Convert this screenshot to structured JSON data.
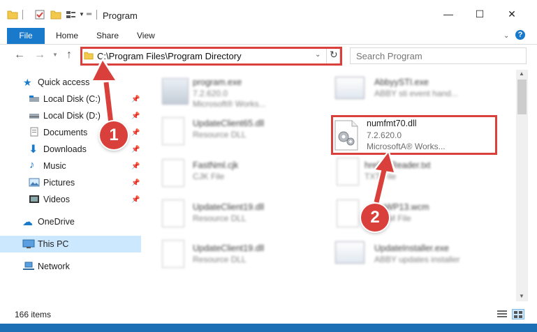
{
  "window": {
    "title": "Program",
    "controls": {
      "minimize": "—",
      "maximize": "☐",
      "close": "✕"
    }
  },
  "ribbon": {
    "tabs": [
      {
        "label": "File"
      },
      {
        "label": "Home"
      },
      {
        "label": "Share"
      },
      {
        "label": "View"
      }
    ],
    "help": "?"
  },
  "navigation": {
    "address_path": "C:\\Program Files\\Program Directory",
    "search_placeholder": "Search Program"
  },
  "sidebar": {
    "quick_access": "Quick access",
    "items": [
      {
        "label": "Local Disk (C:)",
        "icon": "drive-icon"
      },
      {
        "label": "Local Disk (D:)",
        "icon": "drive-icon"
      },
      {
        "label": "Documents",
        "icon": "documents-icon"
      },
      {
        "label": "Downloads",
        "icon": "downloads-icon"
      },
      {
        "label": "Music",
        "icon": "music-icon"
      },
      {
        "label": "Pictures",
        "icon": "pictures-icon"
      },
      {
        "label": "Videos",
        "icon": "videos-icon"
      }
    ],
    "onedrive": "OneDrive",
    "this_pc": "This PC",
    "network": "Network"
  },
  "files": {
    "col1": [
      {
        "name": "program.exe",
        "line2": "7.2.620.0",
        "line3": "Microsoft® Works..."
      },
      {
        "name": "UpdateClient65.dll",
        "line2": "Resource DLL"
      },
      {
        "name": "FastNml.cjk",
        "line2": "CJK File"
      },
      {
        "name": "UpdateClient19.dll",
        "line2": "Resource DLL"
      },
      {
        "name": "UpdateClient19.dll",
        "line2": "Resource DLL"
      }
    ],
    "col2": [
      {
        "name": "AbbyySTI.exe",
        "line2": "ABBY sti event hand..."
      },
      {
        "name": "numfmt70.dll",
        "line2": "7.2.620.0",
        "line3": "MicrosoftA® Works..."
      },
      {
        "name": "hrelineReader.txt",
        "line2": "TXT File"
      },
      {
        "name": "SoWP13.wcm",
        "line2": "WCM File"
      },
      {
        "name": "UpdateInstaller.exe",
        "line2": "ABBY updates installer"
      }
    ]
  },
  "status": {
    "item_count": "166 items"
  },
  "annotations": {
    "step1": "1",
    "step2": "2"
  },
  "colors": {
    "accent": "#1979ca",
    "annotation": "#d9403b",
    "selection": "#cce8ff"
  }
}
